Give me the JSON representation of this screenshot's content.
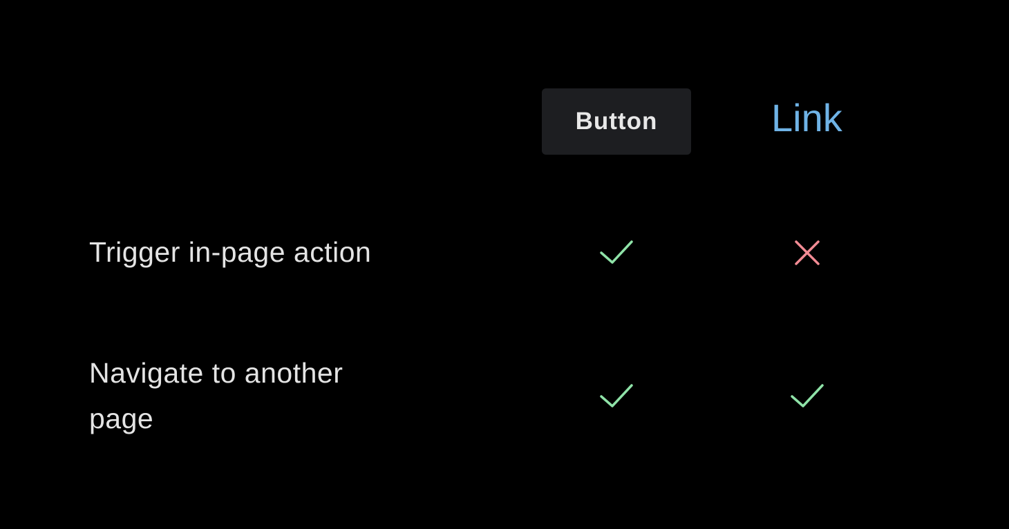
{
  "header": {
    "button_label": "Button",
    "link_label": "Link"
  },
  "rows": [
    {
      "label": "Trigger in-page action",
      "button": "check-icon",
      "link": "x-icon"
    },
    {
      "label": "Navigate to another page",
      "button": "check-icon",
      "link": "check-icon"
    }
  ],
  "colors": {
    "background": "#000000",
    "button_bg": "#1d1e21",
    "link": "#6fb3e6",
    "check": "#8fe3a8",
    "cross": "#f28b94"
  }
}
